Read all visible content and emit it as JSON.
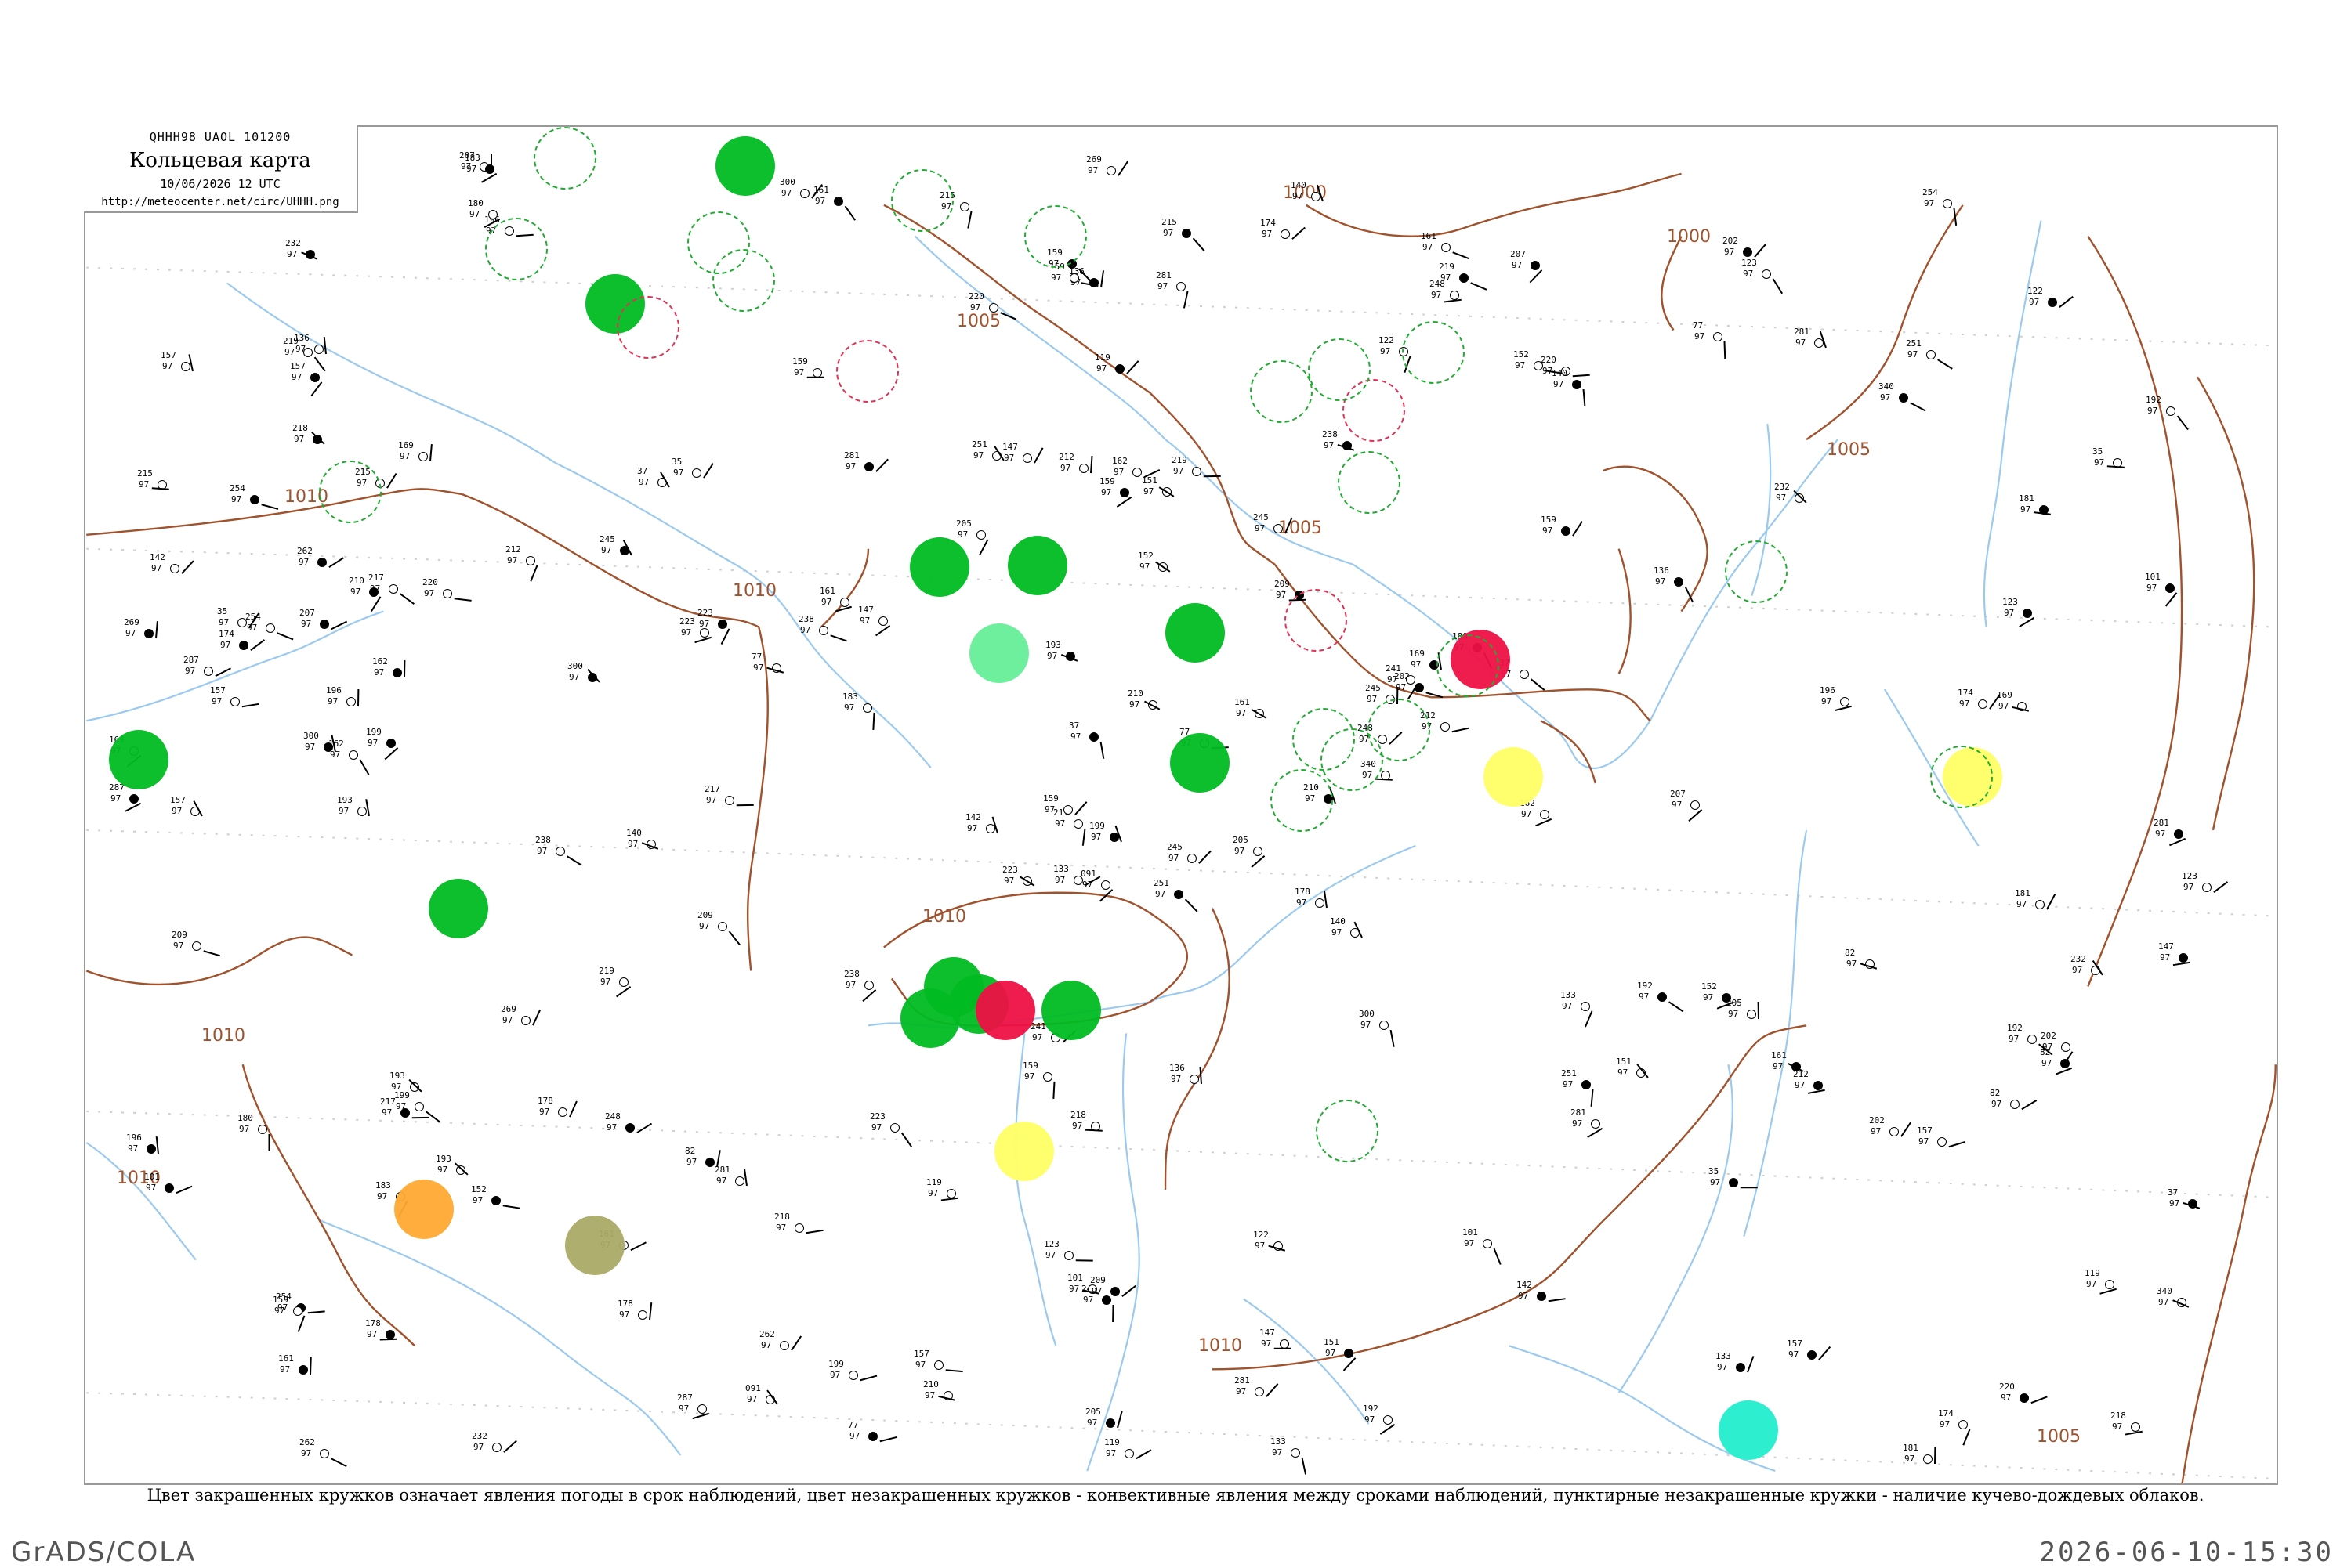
{
  "header": {
    "code": "QHHH98  UAOL  101200",
    "title": "Кольцевая карта",
    "date": "10/06/2026 12 UTC",
    "url": "http://meteocenter.net/circ/UHHH.png"
  },
  "caption": "Цвет закрашенных кружков означает явления погоды в срок наблюдений, цвет незакрашенных кружков - конвективные явления между сроками наблюдений, пунктирные незакрашенные кружки - наличие кучево-дождевых облаков.",
  "footer": {
    "left": "GrADS/COLA",
    "right": "2026-06-10-15:30"
  },
  "isobars": [
    "1000",
    "1000",
    "1005",
    "1005",
    "1005",
    "1010",
    "1010",
    "1010",
    "1010",
    "1010",
    "1010",
    "1005"
  ],
  "colors": {
    "river": "#9ccaee",
    "isobar": "#a0522d",
    "rain": "#00bb22",
    "storm": "#ee1144",
    "fog": "#ffff66",
    "haze": "#ffaa33",
    "dust": "#aaaa66",
    "shower": "#22eecc",
    "conv_dashed": "#22aa33",
    "conv_red": "#dd3355"
  },
  "filled_circles": [
    {
      "kind": "rain"
    },
    {
      "kind": "rain"
    },
    {
      "kind": "rain"
    },
    {
      "kind": "rain"
    },
    {
      "kind": "rain"
    },
    {
      "kind": "rain"
    },
    {
      "kind": "rain"
    },
    {
      "kind": "rain"
    },
    {
      "kind": "rain"
    },
    {
      "kind": "rain"
    },
    {
      "kind": "rain"
    },
    {
      "kind": "rain"
    },
    {
      "kind": "storm"
    },
    {
      "kind": "storm"
    },
    {
      "kind": "fog"
    },
    {
      "kind": "fog"
    },
    {
      "kind": "fog"
    },
    {
      "kind": "haze"
    },
    {
      "kind": "dust"
    },
    {
      "kind": "shower"
    },
    {
      "kind": "rain-light"
    }
  ],
  "stations": [
    {
      "code": "251",
      "name": ""
    },
    {
      "code": "215",
      "name": ""
    },
    {
      "code": "217",
      "name": ""
    },
    {
      "code": "254",
      "name": ""
    },
    {
      "code": "245",
      "name": ""
    },
    {
      "code": "281",
      "name": ""
    },
    {
      "code": "207",
      "name": ""
    },
    {
      "code": "219",
      "name": ""
    },
    {
      "code": "220",
      "name": ""
    },
    {
      "code": "210",
      "name": ""
    },
    {
      "code": "196",
      "name": ""
    },
    {
      "code": "218",
      "name": ""
    },
    {
      "code": "199",
      "name": ""
    },
    {
      "code": "192",
      "name": ""
    },
    {
      "code": "223",
      "name": ""
    },
    {
      "code": "159",
      "name": ""
    },
    {
      "code": "232",
      "name": ""
    },
    {
      "code": "212",
      "name": ""
    },
    {
      "code": "209",
      "name": ""
    },
    {
      "code": "193",
      "name": ""
    },
    {
      "code": "147",
      "name": ""
    },
    {
      "code": "161",
      "name": ""
    },
    {
      "code": "178",
      "name": ""
    },
    {
      "code": "162",
      "name": ""
    },
    {
      "code": "202",
      "name": ""
    },
    {
      "code": "205",
      "name": ""
    },
    {
      "code": "169",
      "name": ""
    },
    {
      "code": "136",
      "name": ""
    },
    {
      "code": "157",
      "name": ""
    },
    {
      "code": "133",
      "name": ""
    },
    {
      "code": "101",
      "name": ""
    },
    {
      "code": "159",
      "name": ""
    },
    {
      "code": "123",
      "name": ""
    },
    {
      "code": "37",
      "name": ""
    },
    {
      "code": "35",
      "name": ""
    },
    {
      "code": "77",
      "name": ""
    },
    {
      "code": "82",
      "name": ""
    },
    {
      "code": "174",
      "name": ""
    },
    {
      "code": "119",
      "name": ""
    },
    {
      "code": "152",
      "name": ""
    },
    {
      "code": "140",
      "name": ""
    },
    {
      "code": "238",
      "name": ""
    },
    {
      "code": "300",
      "name": ""
    },
    {
      "code": "281",
      "name": ""
    },
    {
      "code": "287",
      "name": ""
    },
    {
      "code": "269",
      "name": ""
    },
    {
      "code": "248",
      "name": ""
    },
    {
      "code": "262",
      "name": ""
    },
    {
      "code": "241",
      "name": ""
    },
    {
      "code": "340",
      "name": ""
    },
    {
      "code": "183",
      "name": ""
    },
    {
      "code": "181",
      "name": ""
    },
    {
      "code": "157",
      "name": ""
    },
    {
      "code": "151",
      "name": ""
    },
    {
      "code": "142",
      "name": ""
    },
    {
      "code": "161",
      "name": ""
    },
    {
      "code": "180",
      "name": ""
    },
    {
      "code": "091",
      "name": ""
    },
    {
      "code": "122",
      "name": ""
    }
  ],
  "labels": {
    "p1000": "1000",
    "p1005": "1005",
    "p1010": "1010"
  }
}
